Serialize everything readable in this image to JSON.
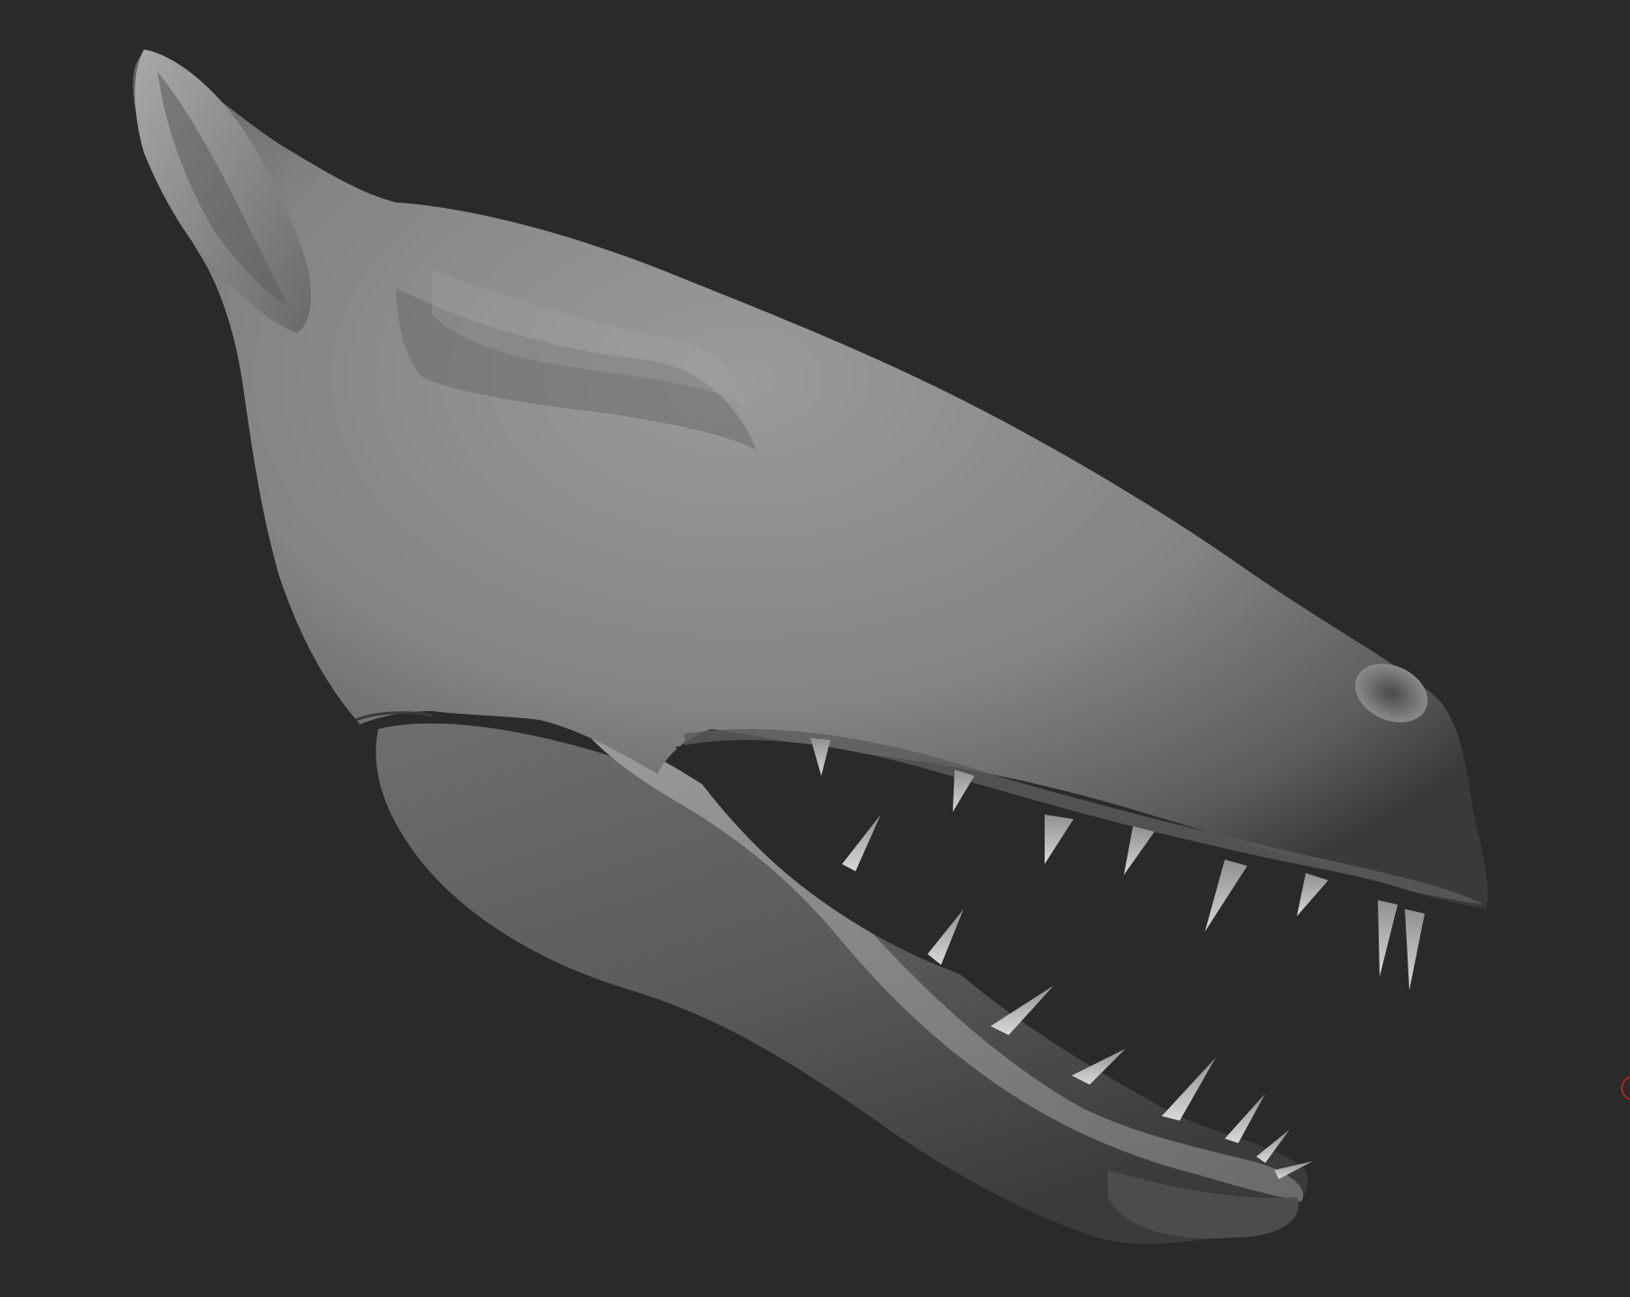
{
  "viewport": {
    "background_color": "#2a2a2b",
    "subject": "sculpted-creature-head-mesh",
    "material_color": "#8a8a8a"
  },
  "overlay": {
    "edge_marker_color": "#b3261e",
    "edge_marker_icon": "circle-outline-icon"
  }
}
